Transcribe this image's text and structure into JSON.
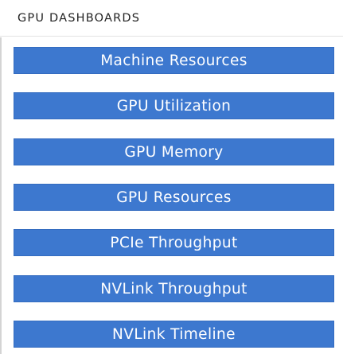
{
  "panel": {
    "title": "GPU DASHBOARDS"
  },
  "buttons": [
    {
      "label": "Machine Resources"
    },
    {
      "label": "GPU Utilization"
    },
    {
      "label": "GPU Memory"
    },
    {
      "label": "GPU Resources"
    },
    {
      "label": "PCIe Throughput"
    },
    {
      "label": "NVLink Throughput"
    },
    {
      "label": "NVLink Timeline"
    }
  ],
  "colors": {
    "button_background": "#3d78cf",
    "button_text": "#ffffff",
    "header_text": "#222222"
  }
}
